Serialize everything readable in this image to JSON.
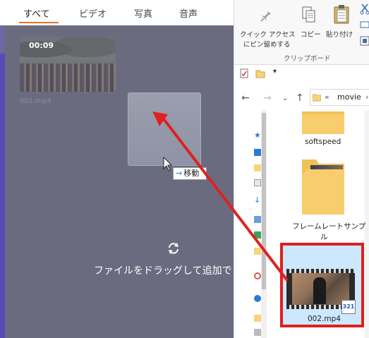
{
  "app": {
    "tabs": [
      {
        "label": "すべて",
        "active": true
      },
      {
        "label": "ビデオ",
        "active": false
      },
      {
        "label": "写真",
        "active": false
      },
      {
        "label": "音声",
        "active": false
      }
    ],
    "media": {
      "duration": "00:09",
      "name": "001.mp4"
    },
    "drop_text": "ファイルをドラッグして追加で",
    "drag_tooltip": "移動",
    "colors": {
      "tab_underline": "#e6721f",
      "body": "#6b6b80",
      "accent_strip": "#5b4ab5"
    }
  },
  "explorer": {
    "ribbon": {
      "pin_label_1": "クイック アクセス",
      "pin_label_2": "にピン留めする",
      "copy_label": "コピー",
      "paste_label": "貼り付け",
      "group_label": "クリップボード"
    },
    "path": {
      "separator": "«",
      "folder": "movie"
    },
    "files": [
      {
        "label": "softspeed",
        "type": "folder"
      },
      {
        "label_1": "フレームレートサンプ",
        "label_2": "ル",
        "type": "folder"
      },
      {
        "label": "002.mp4",
        "type": "video",
        "selected": true,
        "badge": "321"
      }
    ],
    "colors": {
      "selection": "#cce8ff",
      "highlight_border": "#e01e1e"
    }
  },
  "annotation": {
    "arrow_color": "#e02020"
  }
}
